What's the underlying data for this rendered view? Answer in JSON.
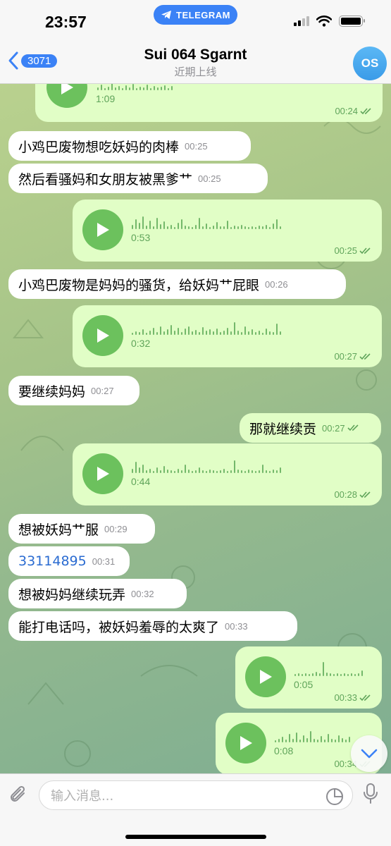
{
  "status_bar": {
    "time": "23:57",
    "app_pill": "TELEGRAM"
  },
  "header": {
    "back_count": "3071",
    "title": "Sui 064 Sgarnt",
    "subtitle": "近期上线",
    "avatar_initials": "OS"
  },
  "messages": [
    {
      "kind": "voice",
      "dir": "out",
      "duration": "1:09",
      "time": "00:24"
    },
    {
      "kind": "text",
      "dir": "in",
      "text": "小鸡巴废物想吃妖妈的肉棒",
      "time": "00:25"
    },
    {
      "kind": "text",
      "dir": "in",
      "text": "然后看骚妈和女朋友被黑爹艹",
      "time": "00:25"
    },
    {
      "kind": "voice",
      "dir": "out",
      "duration": "0:53",
      "time": "00:25"
    },
    {
      "kind": "text",
      "dir": "in",
      "text": "小鸡巴废物是妈妈的骚货，给妖妈艹屁眼",
      "time": "00:26"
    },
    {
      "kind": "voice",
      "dir": "out",
      "duration": "0:32",
      "time": "00:27"
    },
    {
      "kind": "text",
      "dir": "in",
      "text": "要继续妈妈",
      "time": "00:27"
    },
    {
      "kind": "text",
      "dir": "out",
      "text": "那就继续贡",
      "time": "00:27"
    },
    {
      "kind": "voice",
      "dir": "out",
      "duration": "0:44",
      "time": "00:28"
    },
    {
      "kind": "text",
      "dir": "in",
      "text": "想被妖妈艹服",
      "time": "00:29"
    },
    {
      "kind": "text",
      "dir": "in",
      "text": "33114895",
      "time": "00:31"
    },
    {
      "kind": "text",
      "dir": "in",
      "text": "想被妈妈继续玩弄",
      "time": "00:32"
    },
    {
      "kind": "text",
      "dir": "in",
      "text": "能打电话吗，被妖妈羞辱的太爽了",
      "time": "00:33"
    },
    {
      "kind": "voice",
      "dir": "out",
      "duration": "0:05",
      "time": "00:33"
    },
    {
      "kind": "voice",
      "dir": "out",
      "duration": "0:08",
      "time": "00:34"
    }
  ],
  "composer": {
    "placeholder": "输入消息..."
  },
  "colors": {
    "accent": "#3b82f6",
    "outgoing_bubble": "#e1fec6",
    "play_button": "#6cc15d",
    "read_check": "#5fa45a"
  },
  "icons": [
    "telegram-icon",
    "chevron-left-icon",
    "play-icon",
    "double-check-icon",
    "paperclip-icon",
    "sticker-icon",
    "microphone-icon",
    "chevron-down-icon"
  ]
}
